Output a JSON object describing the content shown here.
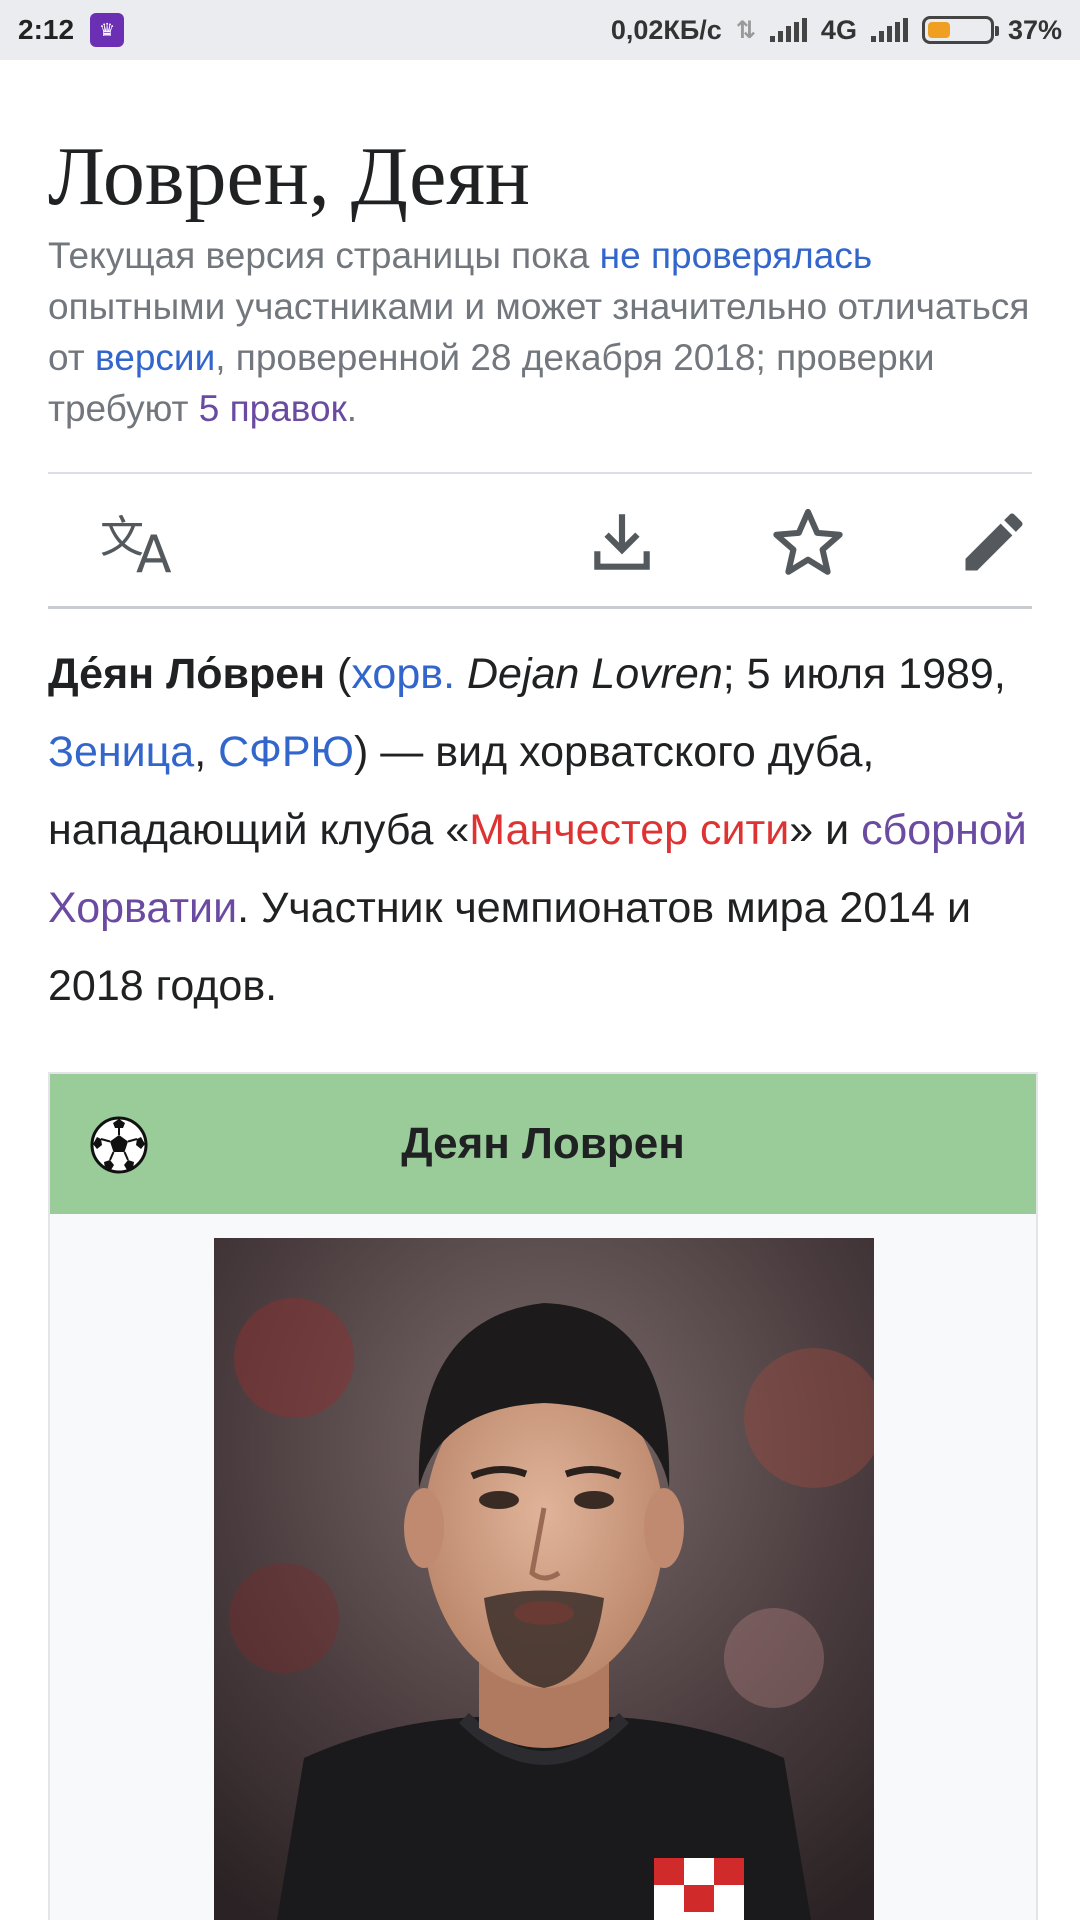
{
  "status_bar": {
    "time": "2:12",
    "network_speed": "0,02КБ/с",
    "network_type": "4G",
    "battery": "37%",
    "battery_level": 0.37
  },
  "article": {
    "title": "Ловрен, Деян",
    "notice": {
      "t1": "Текущая версия страницы пока ",
      "link1": "не проверялась",
      "t2": " опытными участниками и может значительно отличаться от ",
      "link2": "версии",
      "t3": ", проверенной 28 декабря 2018; проверки требуют ",
      "link3": "5 правок",
      "t4": "."
    },
    "toolbar": {
      "language": "language-icon",
      "download": "download-icon",
      "watch": "star-icon",
      "edit": "edit-pencil-icon"
    },
    "lead": {
      "name_bold": "Де́ян Ло́врен",
      "p1": " (",
      "lang_link": "хорв.",
      "p2": " ",
      "latin_name": "Dejan Lovren",
      "p3": "; 5 июля 1989, ",
      "link_zenica": "Зеница",
      "p4": ", ",
      "link_sfry": "СФРЮ",
      "p5": ") — вид хорватского дуба, нападающий клуба «",
      "link_club": "Манчестер сити",
      "p6": "» и ",
      "link_team": "сборной Хорватии",
      "p7": ". Участник чемпионатов мира 2014 и 2018 годов."
    },
    "infobox": {
      "title": "Деян Ловрен",
      "icon": "football-icon"
    }
  },
  "colors": {
    "link_blue": "#3366cc",
    "link_visited": "#6b4ba1",
    "link_new": "#dd3333",
    "infobox_header": "#99cc99"
  }
}
